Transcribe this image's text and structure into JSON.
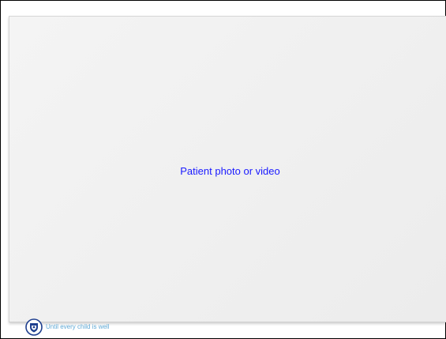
{
  "slide": {
    "placeholder_text": "Patient photo or video",
    "footer_tagline": "Until every child is well",
    "logo_icon": "shield-seal-icon"
  },
  "colors": {
    "placeholder_text": "#1a1aff",
    "tagline": "#5fa9d6",
    "logo_primary": "#1f3f8f"
  }
}
